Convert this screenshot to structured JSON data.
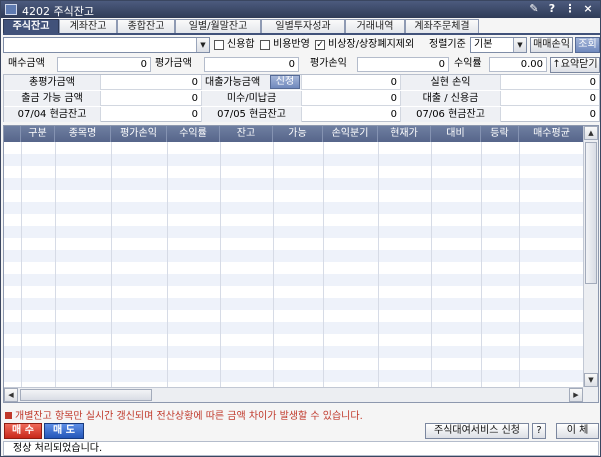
{
  "window": {
    "title": "4202 주식잔고",
    "controls": [
      "✎",
      "?",
      "⋮",
      "×"
    ]
  },
  "tabs": [
    {
      "label": "주식잔고",
      "active": true
    },
    {
      "label": "계좌잔고"
    },
    {
      "label": "종합잔고"
    },
    {
      "label": "일별/월말잔고"
    },
    {
      "label": "일별투자성과"
    },
    {
      "label": "거래내역"
    },
    {
      "label": "계좌주문체결"
    }
  ],
  "filters": {
    "account_value": "",
    "credit_sum_label": "신용합",
    "credit_sum_checked": false,
    "cost_reflect_label": "비용반영",
    "cost_reflect_checked": false,
    "exclude_delisted_label": "비상장/상장폐지제외",
    "exclude_delisted_checked": true,
    "sort_label": "정렬기준",
    "sort_value": "기본",
    "trade_pnl_button": "매매손익",
    "query_button": "조회"
  },
  "totals": {
    "buy_amount_label": "매수금액",
    "buy_amount": "0",
    "eval_amount_label": "평가금액",
    "eval_amount": "0",
    "eval_pnl_label": "평가손익",
    "eval_pnl": "0",
    "return_label": "수익률",
    "return_value": "0.00",
    "summary_toggle": "↑요약닫기"
  },
  "summary": {
    "total_eval_label": "총평가금액",
    "total_eval": "0",
    "loanable_label": "대출가능금액",
    "loan_apply_button": "신청",
    "loanable": "0",
    "realized_pnl_label": "실현 손익",
    "realized_pnl": "0",
    "withdrawable_label": "출금 가능 금액",
    "withdrawable": "0",
    "unpaid_label": "미수/미납금",
    "unpaid": "0",
    "loan_credit_label": "대출 / 신용금",
    "loan_credit": "0",
    "cash_d0_label": "07/04 현금잔고",
    "cash_d0": "0",
    "cash_d1_label": "07/05 현금잔고",
    "cash_d1": "0",
    "cash_d2_label": "07/06 현금잔고",
    "cash_d2": "0"
  },
  "grid": {
    "columns": [
      "구분",
      "종목명",
      "평가손익",
      "수익률",
      "잔고",
      "가능",
      "손익분기",
      "현재가",
      "대비",
      "등락",
      "매수평균"
    ]
  },
  "footer": {
    "notice": "개별잔고 항목만 실시간 갱신되며 전산상황에 따른 금액 차이가 발생할 수 있습니다.",
    "buy_button": "매 수",
    "sell_button": "매 도",
    "lending_button": "주식대여서비스 신청",
    "help_button": "?",
    "transfer_button": "이 체",
    "status": "정상 처리되었습니다."
  },
  "colors": {
    "accent": "#41527a",
    "buy": "#c8281a",
    "sell": "#2456b8",
    "notice": "#c0392b"
  }
}
